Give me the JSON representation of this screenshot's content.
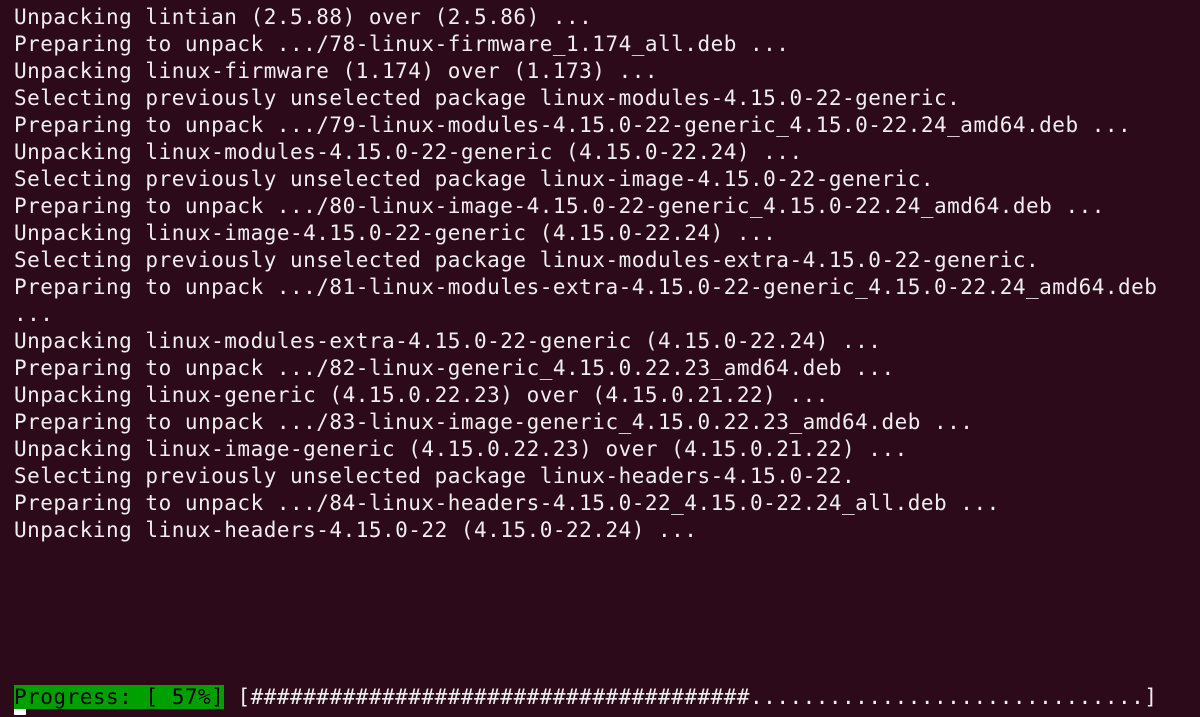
{
  "terminal": {
    "lines": [
      "Unpacking lintian (2.5.88) over (2.5.86) ...",
      "Preparing to unpack .../78-linux-firmware_1.174_all.deb ...",
      "Unpacking linux-firmware (1.174) over (1.173) ...",
      "Selecting previously unselected package linux-modules-4.15.0-22-generic.",
      "Preparing to unpack .../79-linux-modules-4.15.0-22-generic_4.15.0-22.24_amd64.deb ...",
      "Unpacking linux-modules-4.15.0-22-generic (4.15.0-22.24) ...",
      "Selecting previously unselected package linux-image-4.15.0-22-generic.",
      "Preparing to unpack .../80-linux-image-4.15.0-22-generic_4.15.0-22.24_amd64.deb ...",
      "Unpacking linux-image-4.15.0-22-generic (4.15.0-22.24) ...",
      "Selecting previously unselected package linux-modules-extra-4.15.0-22-generic.",
      "Preparing to unpack .../81-linux-modules-extra-4.15.0-22-generic_4.15.0-22.24_amd64.deb ...",
      "Unpacking linux-modules-extra-4.15.0-22-generic (4.15.0-22.24) ...",
      "Preparing to unpack .../82-linux-generic_4.15.0.22.23_amd64.deb ...",
      "Unpacking linux-generic (4.15.0.22.23) over (4.15.0.21.22) ...",
      "Preparing to unpack .../83-linux-image-generic_4.15.0.22.23_amd64.deb ...",
      "Unpacking linux-image-generic (4.15.0.22.23) over (4.15.0.21.22) ...",
      "Selecting previously unselected package linux-headers-4.15.0-22.",
      "Preparing to unpack .../84-linux-headers-4.15.0-22_4.15.0-22.24_all.deb ...",
      "Unpacking linux-headers-4.15.0-22 (4.15.0-22.24) ..."
    ]
  },
  "progress": {
    "label": "Progress: [ 57%]",
    "bar_open": " [",
    "bar_filled": "######################################",
    "bar_empty": "..............................",
    "bar_close": "]"
  }
}
